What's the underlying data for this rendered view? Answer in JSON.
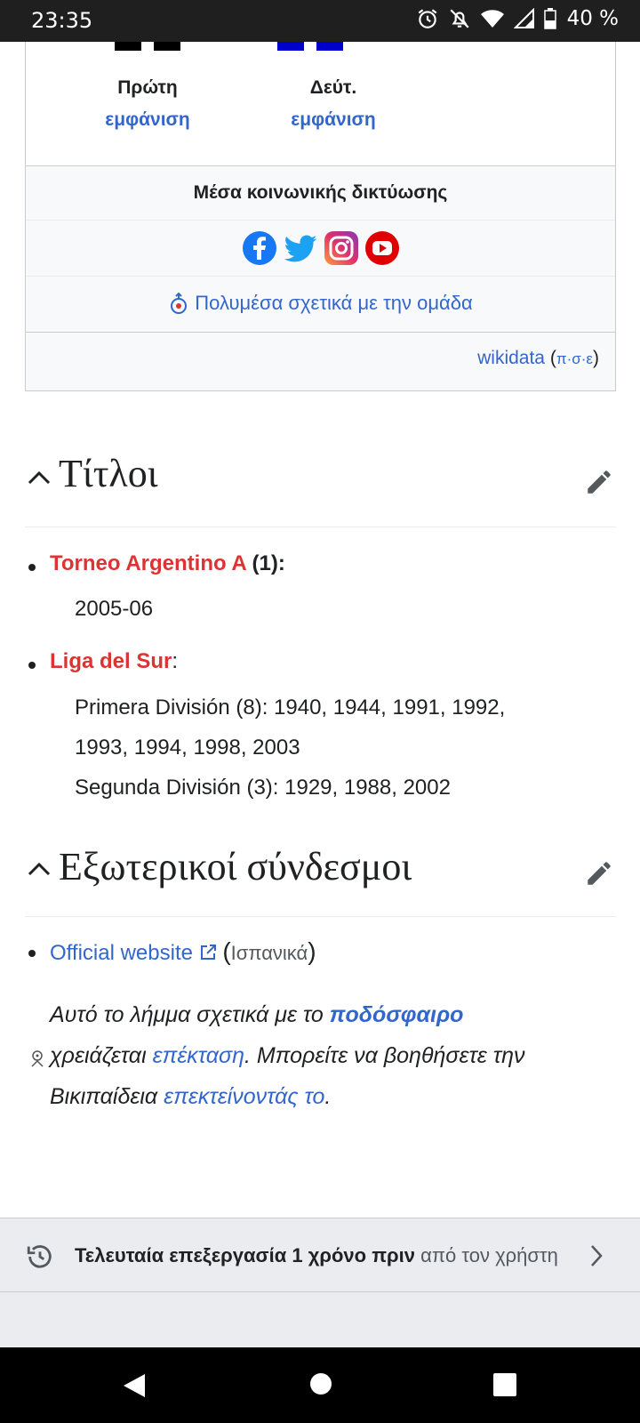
{
  "status_bar": {
    "time": "23:35",
    "battery": "40 %"
  },
  "infobox": {
    "kits": [
      {
        "title": "Πρώτη",
        "link": "εμφάνιση",
        "color": "#000000"
      },
      {
        "title": "Δεύτ.",
        "link": "εμφάνιση",
        "color": "#0000cc"
      }
    ],
    "social_heading": "Μέσα κοινωνικής δικτύωσης",
    "social_icons": [
      "facebook-icon",
      "twitter-icon",
      "instagram-icon",
      "youtube-icon"
    ],
    "commons_link": "Πολυμέσα σχετικά με την ομάδα",
    "wikidata_link": "wikidata",
    "vde": [
      "π",
      "σ",
      "ε"
    ]
  },
  "sections": {
    "titles": {
      "heading": "Τίτλοι",
      "items": [
        {
          "name": "Torneo Argentino A",
          "suffix": " (1):",
          "lines": [
            "2005-06"
          ]
        },
        {
          "name": "Liga del Sur",
          "suffix": ":",
          "lines": [
            "Primera División (8): 1940, 1944, 1991, 1992,",
            "1993, 1994, 1998, 2003",
            "Segunda División (3): 1929, 1988, 2002"
          ]
        }
      ]
    },
    "external": {
      "heading": "Εξωτερικοί σύνδεσμοι",
      "link": "Official website",
      "lang": "Ισπανικά"
    }
  },
  "stub": {
    "part1": "Αυτό το λήμμα σχετικά με το ",
    "topic": "ποδόσφαιρο",
    "part2": "χρειάζεται ",
    "expansion": "επέκταση",
    "part3": ". Μπορείτε να βοηθήσετε την Βικιπαίδεια ",
    "expand": "επεκτείνοντάς το",
    "part4": "."
  },
  "last_edit": {
    "bold": "Τελευταία επεξεργασία 1 χρόνο πριν",
    "rest": " από τον χρήστη"
  },
  "colors": {
    "link": "#3366cc",
    "redlink": "#dd3333",
    "text": "#202122"
  }
}
